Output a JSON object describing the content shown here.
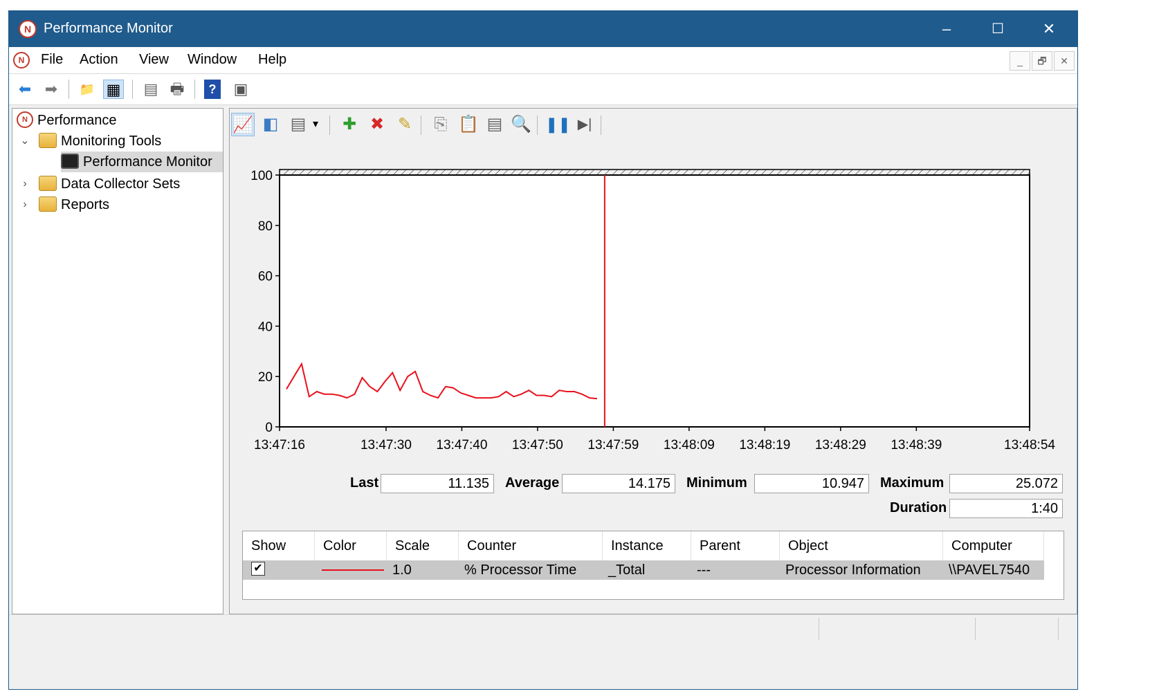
{
  "window": {
    "title": "Performance Monitor",
    "controls": {
      "minimize": "–",
      "maximize": "☐",
      "close": "✕"
    },
    "app_icon": "perfmon-icon"
  },
  "menu": {
    "items": [
      "File",
      "Action",
      "View",
      "Window",
      "Help"
    ],
    "mdi": {
      "minimize": "_",
      "restore": "🗗",
      "close": "✕"
    }
  },
  "toolbar": {
    "icons": [
      "back-arrow-icon",
      "forward-arrow-icon",
      "up-folder-icon",
      "show-hide-tree-icon",
      "properties-icon",
      "print-icon",
      "help-icon",
      "console-icon"
    ],
    "glyphs": {
      "back": "⬅",
      "forward": "➡",
      "up": "📁",
      "tree": "▦",
      "props": "▤",
      "print": "🖶",
      "help": "?",
      "console": "▣"
    }
  },
  "tree": {
    "root": "Performance",
    "monitoring_tools": "Monitoring Tools",
    "performance_monitor": "Performance Monitor",
    "data_collector_sets": "Data Collector Sets",
    "reports": "Reports",
    "expanders": {
      "open": "⌄",
      "closed": "›"
    }
  },
  "graph_toolbar": {
    "glyphs": {
      "view_graph": "📈",
      "view_current": "◧",
      "change_graph": "▤",
      "dropdown": "▾",
      "add": "✚",
      "delete": "✖",
      "highlight": "✎",
      "copy": "⎘",
      "paste": "📋",
      "properties": "▤",
      "zoom": "🔍",
      "freeze": "❚❚",
      "update": "▶|"
    },
    "colors": {
      "add": "#2e9e2e",
      "delete": "#d62828",
      "freeze": "#1f6fbf",
      "update": "#333333"
    }
  },
  "chart_data": {
    "type": "line",
    "ylim": [
      0,
      100
    ],
    "yticks": [
      "0",
      "20",
      "40",
      "60",
      "80",
      "100"
    ],
    "xtick_labels": [
      "13:47:16",
      "13:47:30",
      "13:47:40",
      "13:47:50",
      "13:47:59",
      "13:48:09",
      "13:48:19",
      "13:48:29",
      "13:48:39",
      "13:48:54"
    ],
    "cursor_time": "13:47:59",
    "series": [
      {
        "color": "#e8101c",
        "values": [
          15,
          20,
          25,
          12,
          14,
          13,
          13,
          12.5,
          11.5,
          13,
          19.5,
          16,
          14,
          18,
          21.5,
          14.5,
          20,
          22,
          14,
          12.5,
          11.5,
          16,
          15.5,
          13.5,
          12.5,
          11.5,
          11.5,
          11.5,
          12,
          14,
          12,
          13,
          14.5,
          12.5,
          12.5,
          12,
          14.5,
          14,
          14,
          13,
          11.5,
          11.2
        ]
      }
    ],
    "total_points": 100
  },
  "stats": {
    "last_label": "Last",
    "last": "11.135",
    "average_label": "Average",
    "average": "14.175",
    "minimum_label": "Minimum",
    "minimum": "10.947",
    "maximum_label": "Maximum",
    "maximum": "25.072",
    "duration_label": "Duration",
    "duration": "1:40"
  },
  "counters": {
    "headers": [
      "Show",
      "Color",
      "Scale",
      "Counter",
      "Instance",
      "Parent",
      "Object",
      "Computer"
    ],
    "rows": [
      {
        "checked": "✔",
        "color": "#e8101c",
        "scale": "1.0",
        "counter": "% Processor Time",
        "instance": "_Total",
        "parent": "---",
        "object": "Processor Information",
        "computer": "\\\\PAVEL7540"
      }
    ]
  }
}
